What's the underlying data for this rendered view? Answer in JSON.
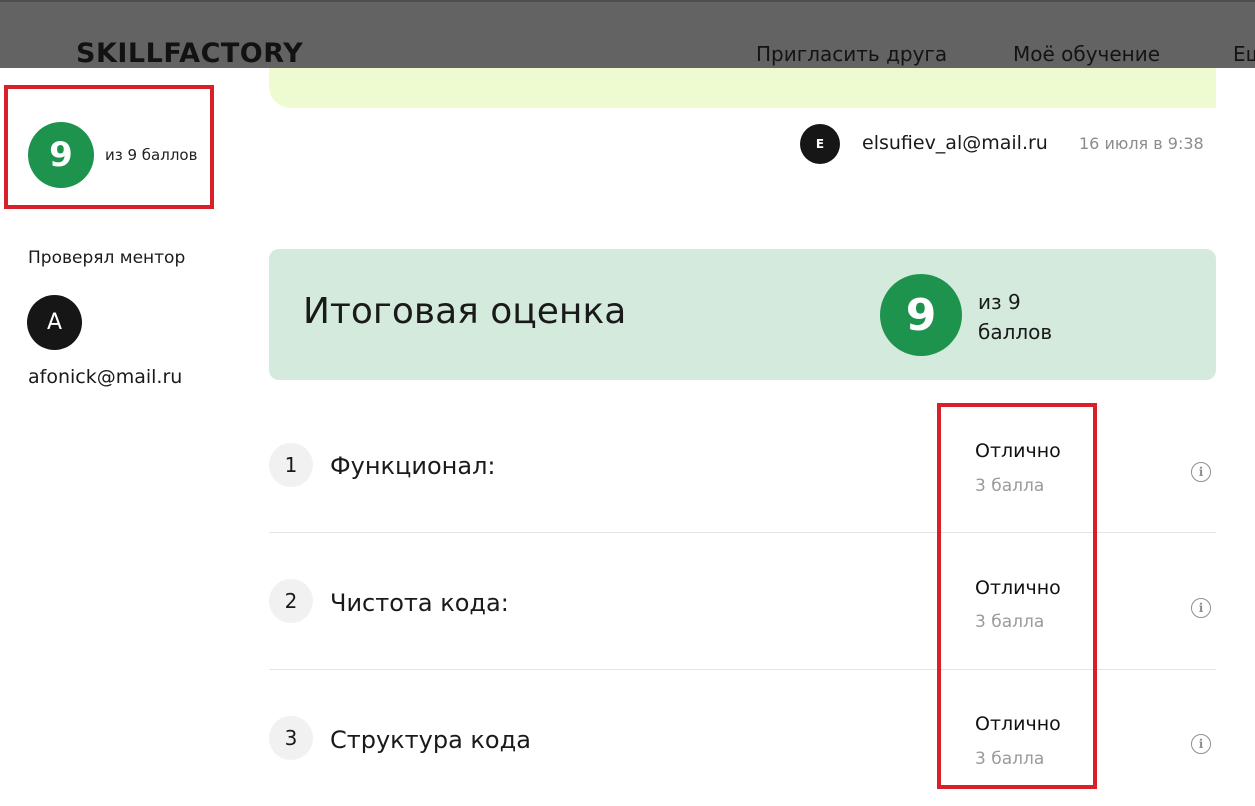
{
  "header": {
    "logo": "SKILLFACTORY",
    "nav": [
      "Пригласить друга",
      "Моё обучение",
      "Ещ"
    ]
  },
  "sidebar": {
    "score": "9",
    "score_of": "из 9 баллов",
    "mentor_label": "Проверял ментор",
    "mentor_avatar": "A",
    "mentor_email": "afonick@mail.ru"
  },
  "submission": {
    "avatar": "E",
    "email": "elsufiev_al@mail.ru",
    "date": "16 июля в 9:38"
  },
  "final": {
    "title": "Итоговая оценка",
    "score": "9",
    "of_line1": "из 9",
    "of_line2": "баллов"
  },
  "criteria": [
    {
      "num": "1",
      "name": "Функционал:",
      "grade": "Отлично",
      "points": "3 балла"
    },
    {
      "num": "2",
      "name": "Чистота кода:",
      "grade": "Отлично",
      "points": "3 балла"
    },
    {
      "num": "3",
      "name": "Структура кода",
      "grade": "Отлично",
      "points": "3 балла"
    }
  ],
  "colors": {
    "accent_green": "#1d934d",
    "highlight_red": "#d8202a",
    "card_bg": "#d3eadd"
  }
}
